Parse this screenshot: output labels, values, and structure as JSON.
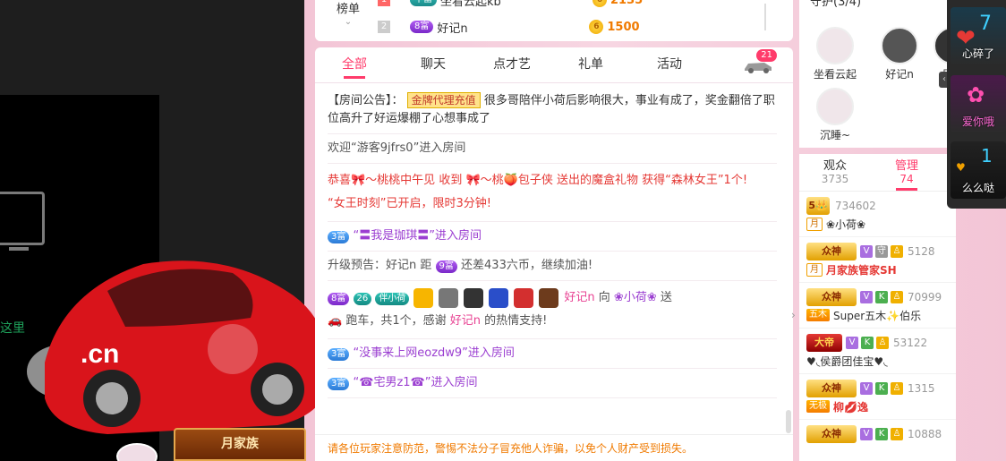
{
  "left": {
    "side_text": "这里",
    "family_button": "月家族"
  },
  "rank": {
    "tab_label": "榜单",
    "rows": [
      {
        "num": "1",
        "badge": "十富",
        "name": "坐看云起kb",
        "score": "2135"
      },
      {
        "num": "2",
        "badge": "8富",
        "name": "好记n",
        "score": "1500"
      }
    ]
  },
  "chat": {
    "tabs": [
      "全部",
      "聊天",
      "点才艺",
      "礼单",
      "活动"
    ],
    "car_count": "21",
    "messages": {
      "notice_label": "【房间公告】：",
      "notice_tag": "金牌代理充值",
      "notice_text": "很多哥陪伴小荷后影响很大，事业有成了，奖金翻倍了职位高升了好运爆棚了心想事成了",
      "welcome_guest": "欢迎“游客9jfrs0”进入房间",
      "gift_line": "恭喜🎀～桃桃中午见 收到 🎀～桃🍑包子侠 送出的魔盒礼物 获得“森林女王”1个!",
      "queen_line": "“女王时刻”已开启，限时3分钟!",
      "enter1_badge": "3富",
      "enter1_text": "“〓我是珈琪〓”进入房间",
      "upgrade_prefix": "升级预告：好记n 距",
      "upgrade_badge": "9富",
      "upgrade_suffix": "还差433六币，继续加油!",
      "send_badge": "8富",
      "send_lv": "26",
      "send_tag": "伴小荷",
      "send_user": "好记n",
      "send_to": "向",
      "send_target": "❀小荷❀",
      "send_verb": "送",
      "send_line2_prefix": "跑车，共1个，感谢",
      "send_line2_user": "好记n",
      "send_line2_suffix": "的热情支持!",
      "enter2_badge": "3富",
      "enter2_text": "“没事来上网eozdw9”进入房间",
      "enter3_badge": "3富",
      "enter3_text": "“☎宅男z1☎”进入房间"
    },
    "footer": "请各位玩家注意防范，警惕不法分子冒充他人诈骗，以免个人财产受到损失。"
  },
  "guard": {
    "title": "守护(3/4)",
    "items": [
      {
        "name": "坐看云起"
      },
      {
        "name": "好记n"
      },
      {
        "name": "月"
      },
      {
        "name": "沉睡~"
      }
    ]
  },
  "users": {
    "tab_audience": "观众",
    "audience_count": "3735",
    "tab_admin": "管理",
    "admin_count": "74",
    "rows": [
      {
        "crown": "5👑",
        "id": "734602",
        "tag": "月",
        "name": "❀小荷❀"
      },
      {
        "crown": "众神",
        "id": "5128",
        "tag": "月",
        "name": "月家族管家SH"
      },
      {
        "crown": "众神",
        "id": "70999",
        "tag": "五木",
        "name": "Super五木✨伯乐"
      },
      {
        "crown": "大帝",
        "id": "53122",
        "tag": "",
        "name": "♥◟侯爵团佳宝♥◟"
      },
      {
        "crown": "众神",
        "id": "1315",
        "tag": "无极",
        "name": "柳💋逸"
      },
      {
        "crown": "众神",
        "id": "10888",
        "tag": "",
        "name": ""
      }
    ]
  },
  "gifts": [
    {
      "label": "心碎了",
      "num": "7"
    },
    {
      "label": "爱你哦",
      "num": ""
    },
    {
      "label": "么么哒",
      "num": "1"
    }
  ]
}
